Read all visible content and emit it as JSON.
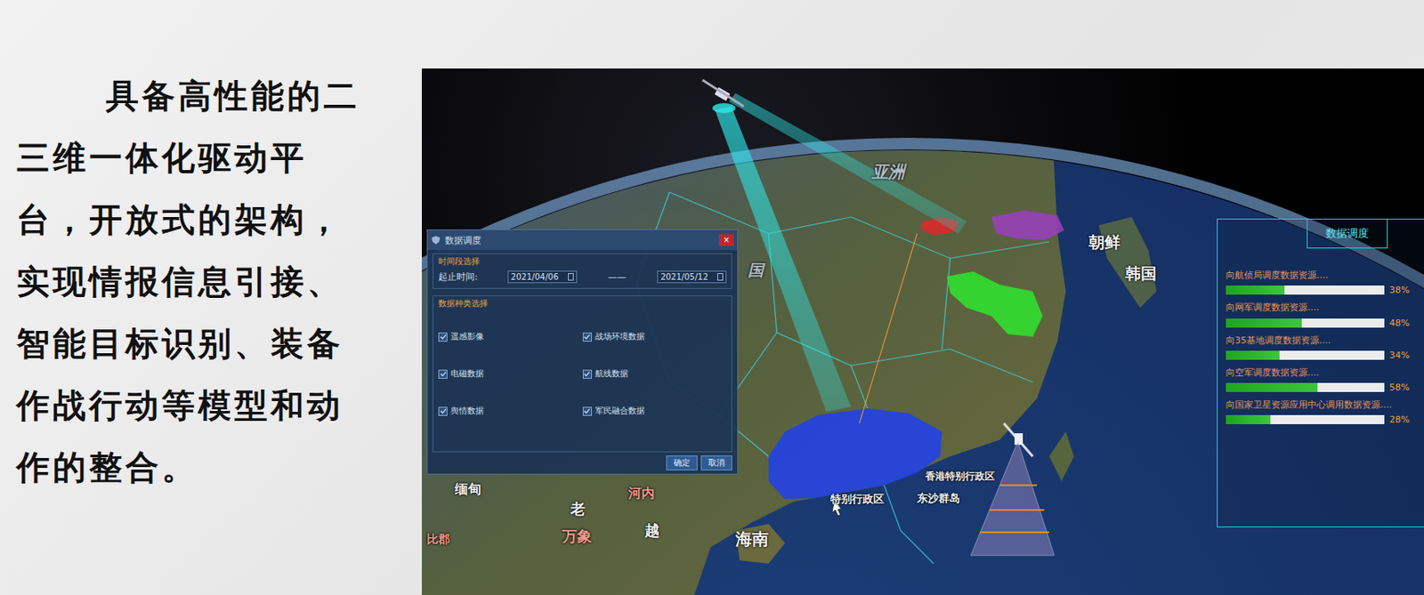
{
  "slide": {
    "text": "具备高性能的二三维一体化驱动平台，开放式的架构，实现情报信息引接、智能目标识别、装备作战行动等模型和动作的整合。"
  },
  "map": {
    "labels": [
      {
        "text": "亚洲"
      },
      {
        "text": "朝鲜"
      },
      {
        "text": "韩国"
      },
      {
        "text": "国"
      },
      {
        "text": "缅甸"
      },
      {
        "text": "老"
      },
      {
        "text": "万象"
      },
      {
        "text": "越"
      },
      {
        "text": "河内"
      },
      {
        "text": "海南"
      },
      {
        "text": "特别行政区"
      },
      {
        "text": "香港特别行政区"
      },
      {
        "text": "东沙群岛"
      },
      {
        "text": "比郡"
      }
    ],
    "highlights": [
      {
        "color": "#e02828"
      },
      {
        "color": "#9a3fc0"
      },
      {
        "color": "#2ee62e"
      },
      {
        "color": "#1f3ff0"
      }
    ]
  },
  "dialog": {
    "title": "数据调度",
    "close": "×",
    "time_section": "时间段选择",
    "time_label": "起止时间:",
    "start": "2021/04/06",
    "separator": "——",
    "end": "2021/05/12",
    "type_section": "数据种类选择",
    "options": [
      {
        "label": "遥感影像",
        "checked": true
      },
      {
        "label": "战场环境数据",
        "checked": true
      },
      {
        "label": "电磁数据",
        "checked": true
      },
      {
        "label": "航线数据",
        "checked": true
      },
      {
        "label": "舆情数据",
        "checked": true
      },
      {
        "label": "军民融合数据",
        "checked": true
      }
    ],
    "buttons": [
      "确定",
      "取消"
    ]
  },
  "panel": {
    "title": "数据调度",
    "rows": [
      {
        "label": "向航侦局调度数据资源....",
        "level": 0.37,
        "reading": "38%"
      },
      {
        "label": "向网军调度数据资源....",
        "level": 0.48,
        "reading": "48%"
      },
      {
        "label": "向35基地调度数据资源....",
        "level": 0.34,
        "reading": "34%"
      },
      {
        "label": "向空军调度数据资源....",
        "level": 0.58,
        "reading": "58%"
      },
      {
        "label": "向国家卫星资源应用中心调用数据资源....",
        "level": 0.28,
        "reading": "28%"
      }
    ]
  }
}
